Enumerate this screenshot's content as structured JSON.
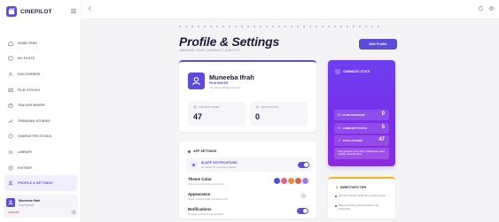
{
  "app": {
    "brand": "CINEPILOT"
  },
  "sidebar": {
    "items": [
      {
        "label": "HOME FEED",
        "icon": "home-icon"
      },
      {
        "label": "MY POSTS",
        "icon": "posts-icon"
      },
      {
        "label": "DISCOVERIES",
        "icon": "compass-icon"
      },
      {
        "label": "FILM STOCKS",
        "icon": "film-icon"
      },
      {
        "label": "TRAILER MAKER",
        "icon": "clapper-icon"
      },
      {
        "label": "TRENDING STORIES",
        "icon": "trending-icon"
      },
      {
        "label": "CHARACTER STUDIO",
        "icon": "character-icon"
      },
      {
        "label": "LIBRARY",
        "icon": "library-icon"
      },
      {
        "label": "HISTORY",
        "icon": "history-icon"
      },
      {
        "label": "PROFILE & SETTINGS",
        "icon": "user-icon",
        "active": true
      }
    ],
    "user": {
      "name": "Muneeba Ifrah",
      "role": "FILM MAKER",
      "logout": "LOGOUT"
    }
  },
  "header": {
    "title": "Profile & Settings",
    "subtitle": "MANAGE YOUR CINEMATIC IDENTITY",
    "edit_button": "Edit Profile"
  },
  "profile": {
    "name": "Muneeba Ifrah",
    "role": "FILM MAKER",
    "email": "muneeba.ifrah@gmail.com",
    "stats": [
      {
        "label": "CONTENT SAVED",
        "value": "47"
      },
      {
        "label": "SHOTS POSTS",
        "value": "0"
      }
    ]
  },
  "settings": {
    "title": "APP SETTINGS",
    "notifications": {
      "label": "IN-APP NOTIFICATIONS",
      "desc": "Get alerts for cinematic insights",
      "on": true
    },
    "theme": {
      "label": "Theme Color",
      "desc": "Choose your favorite accent color",
      "colors": [
        "#5b4bdb",
        "#e0609a",
        "#f28a3b",
        "#e05a5a",
        "#a17be8"
      ]
    },
    "appearance": {
      "label": "Appearance",
      "desc": "Switch between light and dark mode"
    },
    "notif2": {
      "label": "Notifications",
      "desc": "Manage email and alert updates",
      "on": true
    }
  },
  "quick_stats": {
    "title": "CINEMATIC STATS",
    "rows": [
      {
        "label": "FILMS PRODUCED",
        "value": "0"
      },
      {
        "label": "COMMUNITY POSTS",
        "value": "5"
      },
      {
        "label": "TOTAL ACTIONS",
        "value": "47"
      }
    ],
    "note": "Keep great film work with a bright future. Keep creating cinematic films!"
  },
  "tips": {
    "title": "DIRECTOR'S TIPS",
    "items": [
      "Use the Character Studio for consistent actors.",
      "Refine and save great shot plans in the Storyboard."
    ]
  },
  "colors": {
    "accent": "#5b4bdb",
    "gradient_start": "#6d3ff0",
    "gradient_end": "#8e2ae0",
    "tips_accent": "#f2b21b"
  }
}
